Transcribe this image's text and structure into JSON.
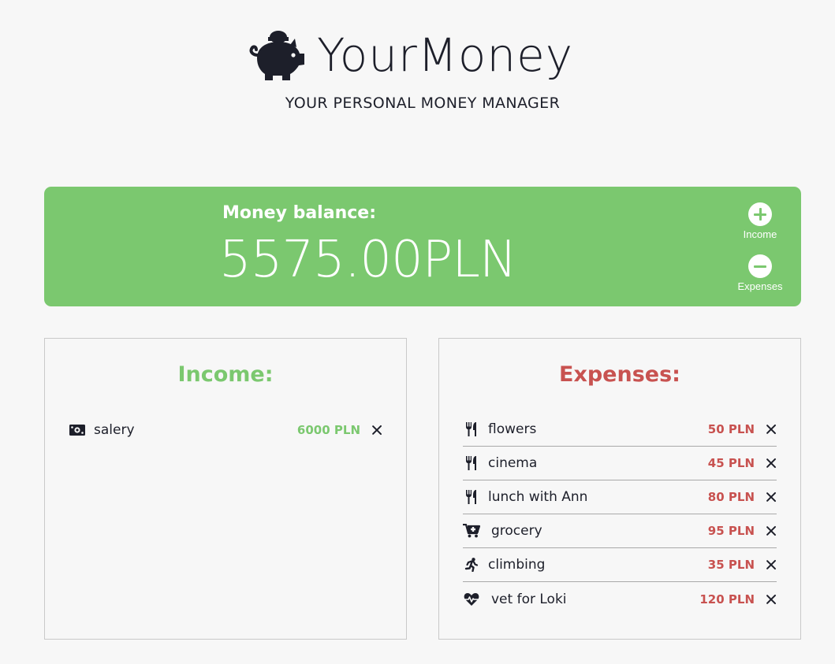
{
  "header": {
    "logo_icon": "piggy-bank-icon",
    "title": "YourMoney",
    "tagline": "YOUR PERSONAL MONEY MANAGER"
  },
  "balance": {
    "label": "Money balance:",
    "value": "5575.00PLN",
    "actions": {
      "income": {
        "icon": "plus-circle-icon",
        "label": "Income"
      },
      "expenses": {
        "icon": "minus-circle-icon",
        "label": "Expenses"
      }
    }
  },
  "income": {
    "title": "Income:",
    "items": [
      {
        "icon": "money-bill-icon",
        "name": "salery",
        "amount": "6000 PLN"
      }
    ]
  },
  "expenses": {
    "title": "Expenses:",
    "items": [
      {
        "icon": "utensils-icon",
        "name": "flowers",
        "amount": "50 PLN"
      },
      {
        "icon": "utensils-icon",
        "name": "cinema",
        "amount": "45 PLN"
      },
      {
        "icon": "utensils-icon",
        "name": "lunch with Ann",
        "amount": "80 PLN"
      },
      {
        "icon": "cart-plus-icon",
        "name": "grocery",
        "amount": "95 PLN"
      },
      {
        "icon": "running-icon",
        "name": "climbing",
        "amount": "35 PLN"
      },
      {
        "icon": "heartbeat-icon",
        "name": "vet for Loki",
        "amount": "120 PLN"
      }
    ]
  },
  "colors": {
    "accent_green": "#7bc86f",
    "expense_red": "#c85250",
    "text_dark": "#1d1f2a",
    "background": "#f7f7f7"
  }
}
